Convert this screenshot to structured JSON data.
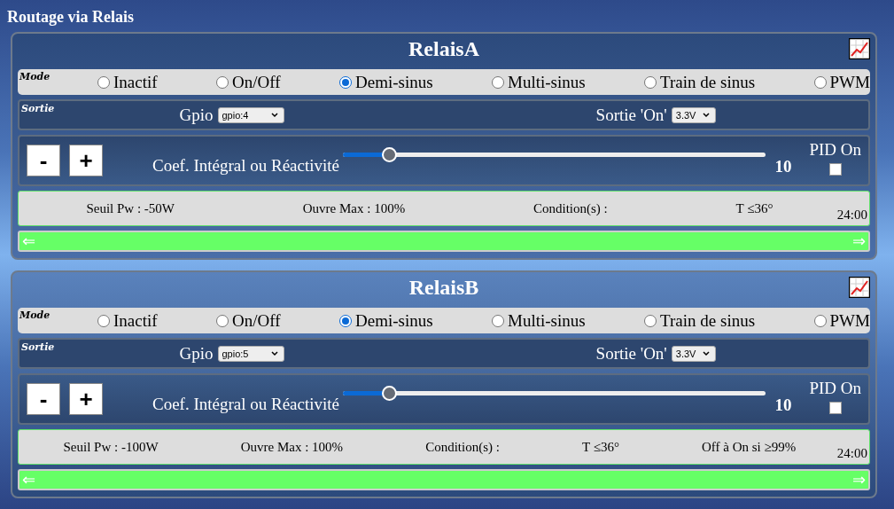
{
  "heading": "Routage via Relais",
  "relays": [
    {
      "title": "RelaisA",
      "mode_label": "Mode",
      "modes": [
        {
          "label": "Inactif",
          "selected": false
        },
        {
          "label": "On/Off",
          "selected": false
        },
        {
          "label": "Demi-sinus",
          "selected": true
        },
        {
          "label": "Multi-sinus",
          "selected": false
        },
        {
          "label": "Train de sinus",
          "selected": false
        },
        {
          "label": "PWM",
          "selected": false
        }
      ],
      "output_label": "Sortie",
      "gpio_label": "Gpio",
      "gpio_value": "gpio:4",
      "on_label": "Sortie 'On'",
      "on_value": "3.3V",
      "minus": "-",
      "plus": "+",
      "coef_label": "Coef. Intégral ou Réactivité",
      "coef": {
        "level": 0.11
      },
      "coef_value": "10",
      "pid_label": "PID On",
      "pid_checked": false,
      "info": [
        "Seuil Pw : -50W",
        "Ouvre Max : 100%",
        "Condition(s) :",
        "T ≤36°"
      ],
      "time": "24:00",
      "arrow_left": "⇐",
      "arrow_right": "⇒"
    },
    {
      "title": "RelaisB",
      "mode_label": "Mode",
      "modes": [
        {
          "label": "Inactif",
          "selected": false
        },
        {
          "label": "On/Off",
          "selected": false
        },
        {
          "label": "Demi-sinus",
          "selected": true
        },
        {
          "label": "Multi-sinus",
          "selected": false
        },
        {
          "label": "Train de sinus",
          "selected": false
        },
        {
          "label": "PWM",
          "selected": false
        }
      ],
      "output_label": "Sortie",
      "gpio_label": "Gpio",
      "gpio_value": "gpio:5",
      "on_label": "Sortie 'On'",
      "on_value": "3.3V",
      "minus": "-",
      "plus": "+",
      "coef_label": "Coef. Intégral ou Réactivité",
      "coef": {
        "level": 0.11
      },
      "coef_value": "10",
      "pid_label": "PID On",
      "pid_checked": false,
      "info": [
        "Seuil Pw : -100W",
        "Ouvre Max : 100%",
        "Condition(s) :",
        "T ≤36°",
        "Off à On si ≥99%"
      ],
      "time": "24:00",
      "arrow_left": "⇐",
      "arrow_right": "⇒"
    }
  ]
}
